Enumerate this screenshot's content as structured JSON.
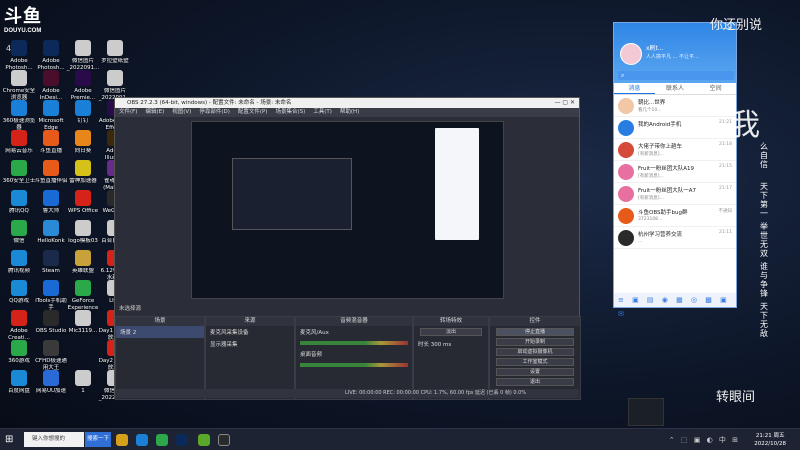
{
  "watermark": {
    "brand": "斗鱼",
    "domain": "DOUYU.COM",
    "room": "4859"
  },
  "desktop_icons": [
    {
      "label": "Adobe Photosh...",
      "color": "#0b2a5a",
      "col": 0,
      "row": 0
    },
    {
      "label": "Adobe Photosh...",
      "color": "#0b2a5a",
      "col": 1,
      "row": 0
    },
    {
      "label": "微信图片_2022091...",
      "color": "#cccccc",
      "col": 2,
      "row": 0
    },
    {
      "label": "罗拉壁纸壁",
      "color": "#cccccc",
      "col": 3,
      "row": 0
    },
    {
      "label": "Chrome安全浏览器",
      "color": "#cccccc",
      "col": 0,
      "row": 1
    },
    {
      "label": "Adobe InDesi...",
      "color": "#4a0d2a",
      "col": 1,
      "row": 1
    },
    {
      "label": "Adobe Premie...",
      "color": "#2a0b4a",
      "col": 2,
      "row": 1
    },
    {
      "label": "微信图片_2022091...",
      "color": "#cccccc",
      "col": 3,
      "row": 1
    },
    {
      "label": "360极速浏览器",
      "color": "#1a7fd6",
      "col": 0,
      "row": 2
    },
    {
      "label": "Microsoft Edge",
      "color": "#1a7fd6",
      "col": 1,
      "row": 2
    },
    {
      "label": "钉钉",
      "color": "#1a7fd6",
      "col": 2,
      "row": 2
    },
    {
      "label": "Adobe After Effects",
      "color": "#2a0b4a",
      "col": 3,
      "row": 2
    },
    {
      "label": "网易云音乐",
      "color": "#d6231a",
      "col": 0,
      "row": 3
    },
    {
      "label": "斗鱼直播",
      "color": "#e85a1a",
      "col": 1,
      "row": 3
    },
    {
      "label": "向日葵",
      "color": "#e8861a",
      "col": 2,
      "row": 3
    },
    {
      "label": "Adobe Illustr...",
      "color": "#3a2a0a",
      "col": 3,
      "row": 3
    },
    {
      "label": "360安全卫士",
      "color": "#2aa84a",
      "col": 0,
      "row": 4
    },
    {
      "label": "斗鱼直播伴侣",
      "color": "#e85a1a",
      "col": 1,
      "row": 4
    },
    {
      "label": "雷神加速器",
      "color": "#d6c01a",
      "col": 2,
      "row": 4
    },
    {
      "label": "雀魂麻将(Mahjo...",
      "color": "#6a2a8a",
      "col": 3,
      "row": 4
    },
    {
      "label": "腾讯QQ",
      "color": "#1a8ad6",
      "col": 0,
      "row": 5
    },
    {
      "label": "鲁大师",
      "color": "#1a6ad6",
      "col": 1,
      "row": 5
    },
    {
      "label": "WPS Office",
      "color": "#d6231a",
      "col": 2,
      "row": 5
    },
    {
      "label": "WeGame",
      "color": "#2a2a2a",
      "col": 3,
      "row": 5
    },
    {
      "label": "微信",
      "color": "#2aa84a",
      "col": 0,
      "row": 6
    },
    {
      "label": "HelloKonk",
      "color": "#2a8ad6",
      "col": 1,
      "row": 6
    },
    {
      "label": "logo模板03",
      "color": "#cccccc",
      "col": 2,
      "row": 6
    },
    {
      "label": "百合自愈吧",
      "color": "#cccccc",
      "col": 3,
      "row": 6
    },
    {
      "label": "腾讯视频",
      "color": "#1a8ad6",
      "col": 0,
      "row": 7
    },
    {
      "label": "Steam",
      "color": "#1a2a4a",
      "col": 1,
      "row": 7
    },
    {
      "label": "英雄联盟",
      "color": "#c9a13a",
      "col": 2,
      "row": 7
    },
    {
      "label": "6.12中国中水新股",
      "color": "#d6231a",
      "col": 3,
      "row": 7
    },
    {
      "label": "QQ游戏",
      "color": "#1a8ad6",
      "col": 0,
      "row": 8
    },
    {
      "label": "iTools手机助手",
      "color": "#1a6ad6",
      "col": 1,
      "row": 8
    },
    {
      "label": "GeForce Experience",
      "color": "#2aa84a",
      "col": 2,
      "row": 8
    },
    {
      "label": "Lh...",
      "color": "#cccccc",
      "col": 3,
      "row": 8
    },
    {
      "label": "Adobe Creati...",
      "color": "#d6231a",
      "col": 0,
      "row": 9
    },
    {
      "label": "OBS Studio",
      "color": "#2a2a2a",
      "col": 1,
      "row": 9
    },
    {
      "label": "Mic3119...",
      "color": "#cccccc",
      "col": 2,
      "row": 9
    },
    {
      "label": "Day1 开幕大放送3",
      "color": "#d6231a",
      "col": 3,
      "row": 9
    },
    {
      "label": "360游戏",
      "color": "#2aa84a",
      "col": 0,
      "row": 10
    },
    {
      "label": "CFHD极速通用大王",
      "color": "#3a3a3a",
      "col": 1,
      "row": 10
    },
    {
      "label": "Day2 开幕大放送4",
      "color": "#d6231a",
      "col": 3,
      "row": 10
    },
    {
      "label": "百度网盘",
      "color": "#1a8ad6",
      "col": 0,
      "row": 11
    },
    {
      "label": "网易UU加速",
      "color": "#2a6ad6",
      "col": 1,
      "row": 11
    },
    {
      "label": "1",
      "color": "#cccccc",
      "col": 2,
      "row": 11
    },
    {
      "label": "微信图片_2022081...",
      "color": "#cccccc",
      "col": 3,
      "row": 11
    },
    {
      "label": "观影300-240",
      "color": "#cccccc",
      "col": 4,
      "row": 11
    }
  ],
  "obs": {
    "title": "OBS 27.2.3 (64-bit, windows) - 配置文件: 未命名 - 场景: 未命名",
    "window_controls": "—  ▢  ✕",
    "menu": [
      "文件(F)",
      "编辑(E)",
      "视图(V)",
      "停靠部件(D)",
      "配置文件(P)",
      "场景集合(S)",
      "工具(T)",
      "帮助(H)"
    ],
    "scene_bar": "未选择源",
    "docks": {
      "scenes": {
        "title": "场景",
        "items": [
          "场景 2"
        ]
      },
      "sources": {
        "title": "来源",
        "items": [
          "麦克风采集设备",
          "显示器采集"
        ]
      },
      "mixer": {
        "title": "音频混音器",
        "tracks": [
          "麦克风/Aux",
          "桌面音频"
        ]
      },
      "transitions": {
        "title": "转场特效",
        "mode": "淡出",
        "duration_label": "时长",
        "duration": "300 ms"
      },
      "controls": {
        "title": "控件",
        "buttons": [
          "停止直播",
          "开始录制",
          "启动虚拟摄像机",
          "工作室模式",
          "设置",
          "退出"
        ]
      }
    },
    "status": "LIVE: 00:00:00   REC: 00:00:00   CPU: 1.7%, 60.00 fps   延迟 (已丢 0 帧) 0.0%"
  },
  "chat_panel": {
    "username": "x刷t...",
    "signature": "人人搞平凡 ... 不让平...",
    "tabs": [
      "消息",
      "联系人",
      "空间"
    ],
    "active_tab": 0,
    "items": [
      {
        "name": "朝比...世界",
        "preview": "看几个10...",
        "time": "",
        "color": "#f2c7a5"
      },
      {
        "name": "我的Android手机",
        "preview": "",
        "time": "21:21",
        "color": "#2a7de0"
      },
      {
        "name": "大佬子带你上趟车",
        "preview": "[有新消息]...",
        "time": "21:18",
        "color": "#d64a3a"
      },
      {
        "name": "Fruit一粉丝团大队A19",
        "preview": "[有新消息]...",
        "time": "21:15",
        "color": "#e870a0"
      },
      {
        "name": "Fruit一粉丝团大队一A7",
        "preview": "[有新消息]...",
        "time": "21:17",
        "color": "#e870a0"
      },
      {
        "name": "斗鱼OBS助手bug群",
        "preview": "3723108...",
        "time": "不通知",
        "color": "#e85a1a"
      },
      {
        "name": "杭州学习营养交流",
        "preview": "...",
        "time": "21:11",
        "color": "#2a2a2a"
      }
    ],
    "bottom_icons": "≡ ▣ ▤ ◉ ▦ ◎ ▩ ▣ ✉"
  },
  "right_text": {
    "top": "你还别说",
    "big": "我",
    "cols": [
      "么自信",
      "天下第一",
      "举世无双",
      "谁与争锋",
      "天下无敌"
    ],
    "bottom": "转眼间"
  },
  "taskbar": {
    "start_icon": "windows-icon",
    "search_placeholder": "键入你想搜的",
    "search_button": "搜索一下",
    "tray": "⌃ ⬚ ▣ ◐ 中 ⊞",
    "time": "21:21 周五",
    "date": "2022/10/28"
  }
}
